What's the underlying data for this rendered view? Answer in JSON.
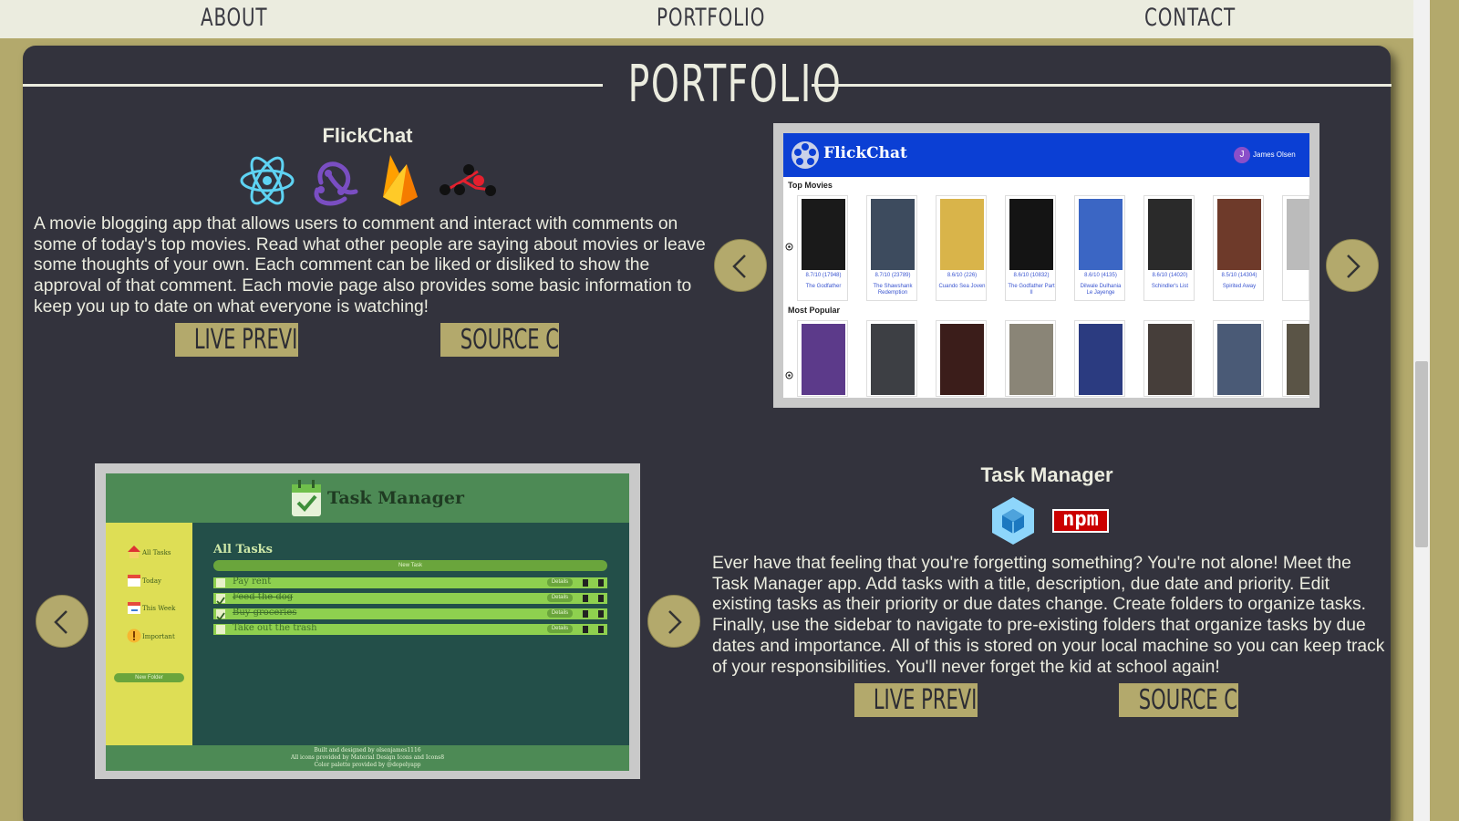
{
  "nav": {
    "about": "ABOUT",
    "portfolio": "PORTFOLIO",
    "contact": "CONTACT"
  },
  "section": {
    "title": "PORTFOLIO"
  },
  "projects": [
    {
      "title": "FlickChat",
      "tech_icons": [
        "react-icon",
        "redux-icon",
        "firebase-icon",
        "api-network-icon"
      ],
      "description": "A movie blogging app that allows users to comment and interact with comments on some of today's top movies. Read what other people are saying about movies or leave some thoughts of your own. Each comment can be liked or disliked to show the approval of that comment. Each movie page also provides some basic information to keep you up to date on what everyone is watching!",
      "live_label": "LIVE PREVIEW",
      "source_label": "SOURCE CODE",
      "screenshot": {
        "app_name": "FlickChat",
        "user": "James Olsen",
        "user_initial": "J",
        "section1": "Top Movies",
        "section2": "Most Popular",
        "top_movies": [
          {
            "name": "The Godfather",
            "rating": "8.7/10 (17948)"
          },
          {
            "name": "The Shawshank Redemption",
            "rating": "8.7/10 (23789)"
          },
          {
            "name": "Cuando Sea Joven",
            "rating": "8.6/10 (226)"
          },
          {
            "name": "The Godfather Part II",
            "rating": "8.6/10 (10832)"
          },
          {
            "name": "Dilwale Dulhania Le Jayenge",
            "rating": "8.6/10 (4135)"
          },
          {
            "name": "Schindler's List",
            "rating": "8.6/10 (14020)"
          },
          {
            "name": "Spirited Away",
            "rating": "8.5/10 (14304)"
          }
        ]
      }
    },
    {
      "title": "Task Manager",
      "tech_icons": [
        "webpack-icon",
        "npm-icon"
      ],
      "npm_text": "npm",
      "description": "Ever have that feeling that you're forgetting something? You're not alone! Meet the Task Manager app. Add tasks with a title, description, due date and priority. Edit existing tasks as their priority or due dates change. Create folders to organize tasks. Finally, use the sidebar to navigate to pre-existing folders that organize tasks by due dates and importance. All of this is stored on your local machine so you can keep track of your responsibilities. You'll never forget the kid at school again!",
      "live_label": "LIVE PREVIEW",
      "source_label": "SOURCE CODE",
      "screenshot": {
        "app_name": "Task Manager",
        "heading": "All Tasks",
        "new_task": "New Task",
        "new_folder": "New Folder",
        "sidebar": [
          "All Tasks",
          "Today",
          "This Week",
          "Important"
        ],
        "tasks": [
          {
            "title": "Pay rent",
            "done": false
          },
          {
            "title": "Feed the dog",
            "done": true
          },
          {
            "title": "Buy groceries",
            "done": true
          },
          {
            "title": "Take out the trash",
            "done": false
          }
        ],
        "details_label": "Details",
        "footer": [
          "Built and designed by olsenjames1116",
          "All icons provided by Material Design Icons and Icons8",
          "Color palette provided by @dopelyapp"
        ]
      }
    }
  ],
  "colors": {
    "accent": "#b3a96c",
    "card": "#33333d",
    "nav": "#ebecdf",
    "text": "#ebecdf"
  }
}
